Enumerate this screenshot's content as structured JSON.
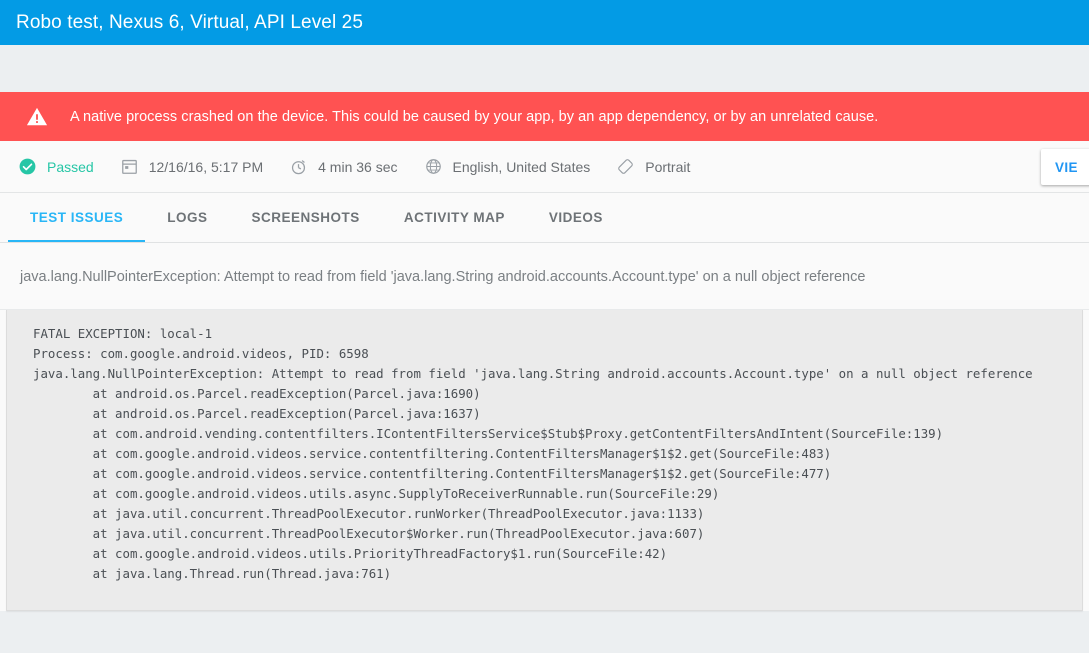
{
  "appbar": {
    "title": "Robo test, Nexus 6, Virtual, API Level 25"
  },
  "colors": {
    "appbar_blue": "#039be5",
    "error_red": "#ff5252",
    "passed_green": "#26c6a6",
    "tab_active_blue": "#29b6f6",
    "page_background": "#eceff1",
    "log_background": "#ebebeb"
  },
  "error_banner": {
    "icon": "warning-triangle-icon",
    "message": "A native process crashed on the device. This could be caused by your app, by an app dependency, or by an unrelated cause."
  },
  "meta": {
    "items": [
      {
        "icon": "check-circle-icon",
        "label": "Passed"
      },
      {
        "icon": "calendar-icon",
        "label": "12/16/16, 5:17 PM"
      },
      {
        "icon": "stopwatch-icon",
        "label": "4 min 36 sec"
      },
      {
        "icon": "globe-icon",
        "label": "English, United States"
      },
      {
        "icon": "screen-rotation-icon",
        "label": "Portrait"
      }
    ],
    "view_button_label": "VIE"
  },
  "tabs": [
    {
      "label": "TEST ISSUES",
      "active": true
    },
    {
      "label": "LOGS",
      "active": false
    },
    {
      "label": "SCREENSHOTS",
      "active": false
    },
    {
      "label": "ACTIVITY MAP",
      "active": false
    },
    {
      "label": "VIDEOS",
      "active": false
    }
  ],
  "issue": {
    "title": "java.lang.NullPointerException: Attempt to read from field 'java.lang.String android.accounts.Account.type' on a null object reference",
    "log_lines": [
      "FATAL EXCEPTION: local-1",
      "Process: com.google.android.videos, PID: 6598",
      "java.lang.NullPointerException: Attempt to read from field 'java.lang.String android.accounts.Account.type' on a null object reference",
      "        at android.os.Parcel.readException(Parcel.java:1690)",
      "        at android.os.Parcel.readException(Parcel.java:1637)",
      "        at com.android.vending.contentfilters.IContentFiltersService$Stub$Proxy.getContentFiltersAndIntent(SourceFile:139)",
      "        at com.google.android.videos.service.contentfiltering.ContentFiltersManager$1$2.get(SourceFile:483)",
      "        at com.google.android.videos.service.contentfiltering.ContentFiltersManager$1$2.get(SourceFile:477)",
      "        at com.google.android.videos.utils.async.SupplyToReceiverRunnable.run(SourceFile:29)",
      "        at java.util.concurrent.ThreadPoolExecutor.runWorker(ThreadPoolExecutor.java:1133)",
      "        at java.util.concurrent.ThreadPoolExecutor$Worker.run(ThreadPoolExecutor.java:607)",
      "        at com.google.android.videos.utils.PriorityThreadFactory$1.run(SourceFile:42)",
      "        at java.lang.Thread.run(Thread.java:761)"
    ]
  }
}
